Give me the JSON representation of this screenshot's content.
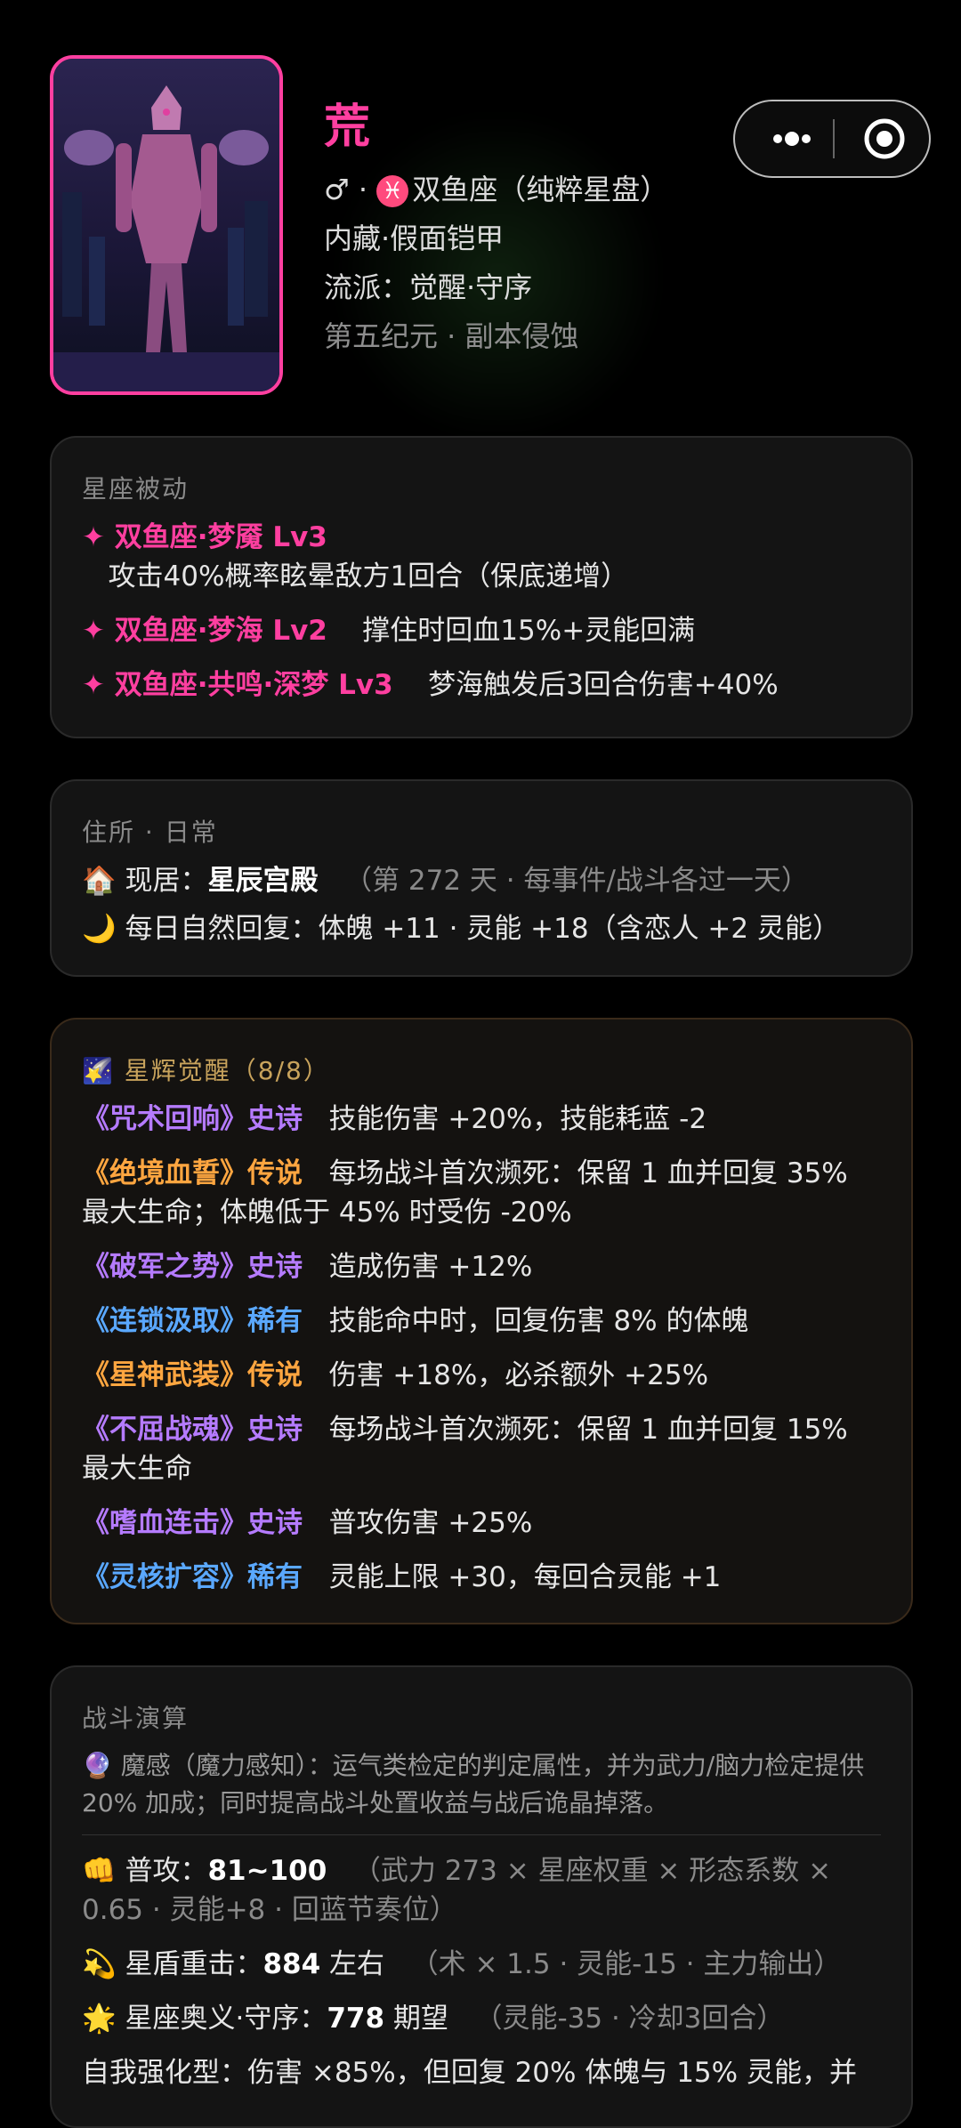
{
  "profile": {
    "name": "荒",
    "gender_symbol": "♂",
    "dot": "·",
    "pisces_glyph": "♓",
    "constellation": "双鱼座（纯粹星盘）",
    "line2": "内藏·假面铠甲",
    "line3": "流派：觉醒·守序",
    "line4": "第五纪元 · 副本侵蚀"
  },
  "passive": {
    "title": "星座被动",
    "items": [
      {
        "name": "✦ 双鱼座·梦魇 Lv3",
        "desc": "攻击40%概率眩晕敌方1回合（保底递增）"
      },
      {
        "name": "✦ 双鱼座·梦海 Lv2",
        "desc": "撑住时回血15%+灵能回满"
      },
      {
        "name": "✦ 双鱼座·共鸣·深梦 Lv3",
        "desc": "梦海触发后3回合伤害+40%"
      }
    ]
  },
  "residence": {
    "title": "住所 · 日常",
    "home_icon": "🏠",
    "home_label": "现居：",
    "home_value": "星辰宫殿",
    "home_note": "（第 272 天 · 每事件/战斗各过一天）",
    "moon_icon": "🌙",
    "daily": "每日自然回复：体魄 +11 · 灵能 +18（含恋人 +2 灵能）"
  },
  "awakening": {
    "icon": "🌠",
    "title": "星辉觉醒（8/8）",
    "items": [
      {
        "name": "《咒术回响》史诗",
        "tier": "purple",
        "desc": "技能伤害 +20%，技能耗蓝 -2"
      },
      {
        "name": "《绝境血誓》传说",
        "tier": "orange",
        "desc": "每场战斗首次濒死：保留 1 血并回复 35% 最大生命；体魄低于 45% 时受伤 -20%"
      },
      {
        "name": "《破军之势》史诗",
        "tier": "purple",
        "desc": "造成伤害 +12%"
      },
      {
        "name": "《连锁汲取》稀有",
        "tier": "blue",
        "desc": "技能命中时，回复伤害 8% 的体魄"
      },
      {
        "name": "《星神武装》传说",
        "tier": "orange",
        "desc": "伤害 +18%，必杀额外 +25%"
      },
      {
        "name": "《不屈战魂》史诗",
        "tier": "purple",
        "desc": "每场战斗首次濒死：保留 1 血并回复 15% 最大生命"
      },
      {
        "name": "《嗜血连击》史诗",
        "tier": "purple",
        "desc": "普攻伤害 +25%"
      },
      {
        "name": "《灵核扩容》稀有",
        "tier": "blue",
        "desc": "灵能上限 +30，每回合灵能 +1"
      }
    ]
  },
  "combat": {
    "title": "战斗演算",
    "sense_icon": "🔮",
    "sense": "魔感（魔力感知）：运气类检定的判定属性，并为武力/脑力检定提供 20% 加成；同时提高战斗处置收益与战后诡晶掉落。",
    "attack_icon": "👊",
    "attack_label": "普攻：",
    "attack_value": "81~100",
    "attack_note": "（武力 273 × 星座权重 × 形态系数 × 0.65 · 灵能+8 · 回蓝节奏位）",
    "heavy_icon": "💫",
    "heavy_label": "星盾重击：",
    "heavy_value": "884",
    "heavy_unit": "左右",
    "heavy_note": "（术 × 1.5 · 灵能-15 · 主力输出）",
    "ult_icon": "🌟",
    "ult_label": "星座奥义·守序：",
    "ult_value": "778",
    "ult_unit": "期望",
    "ult_note": "（灵能-35 · 冷却3回合）",
    "last": "自我强化型：伤害 ×85%，但回复 20% 体魄与 15% 灵能，并"
  }
}
